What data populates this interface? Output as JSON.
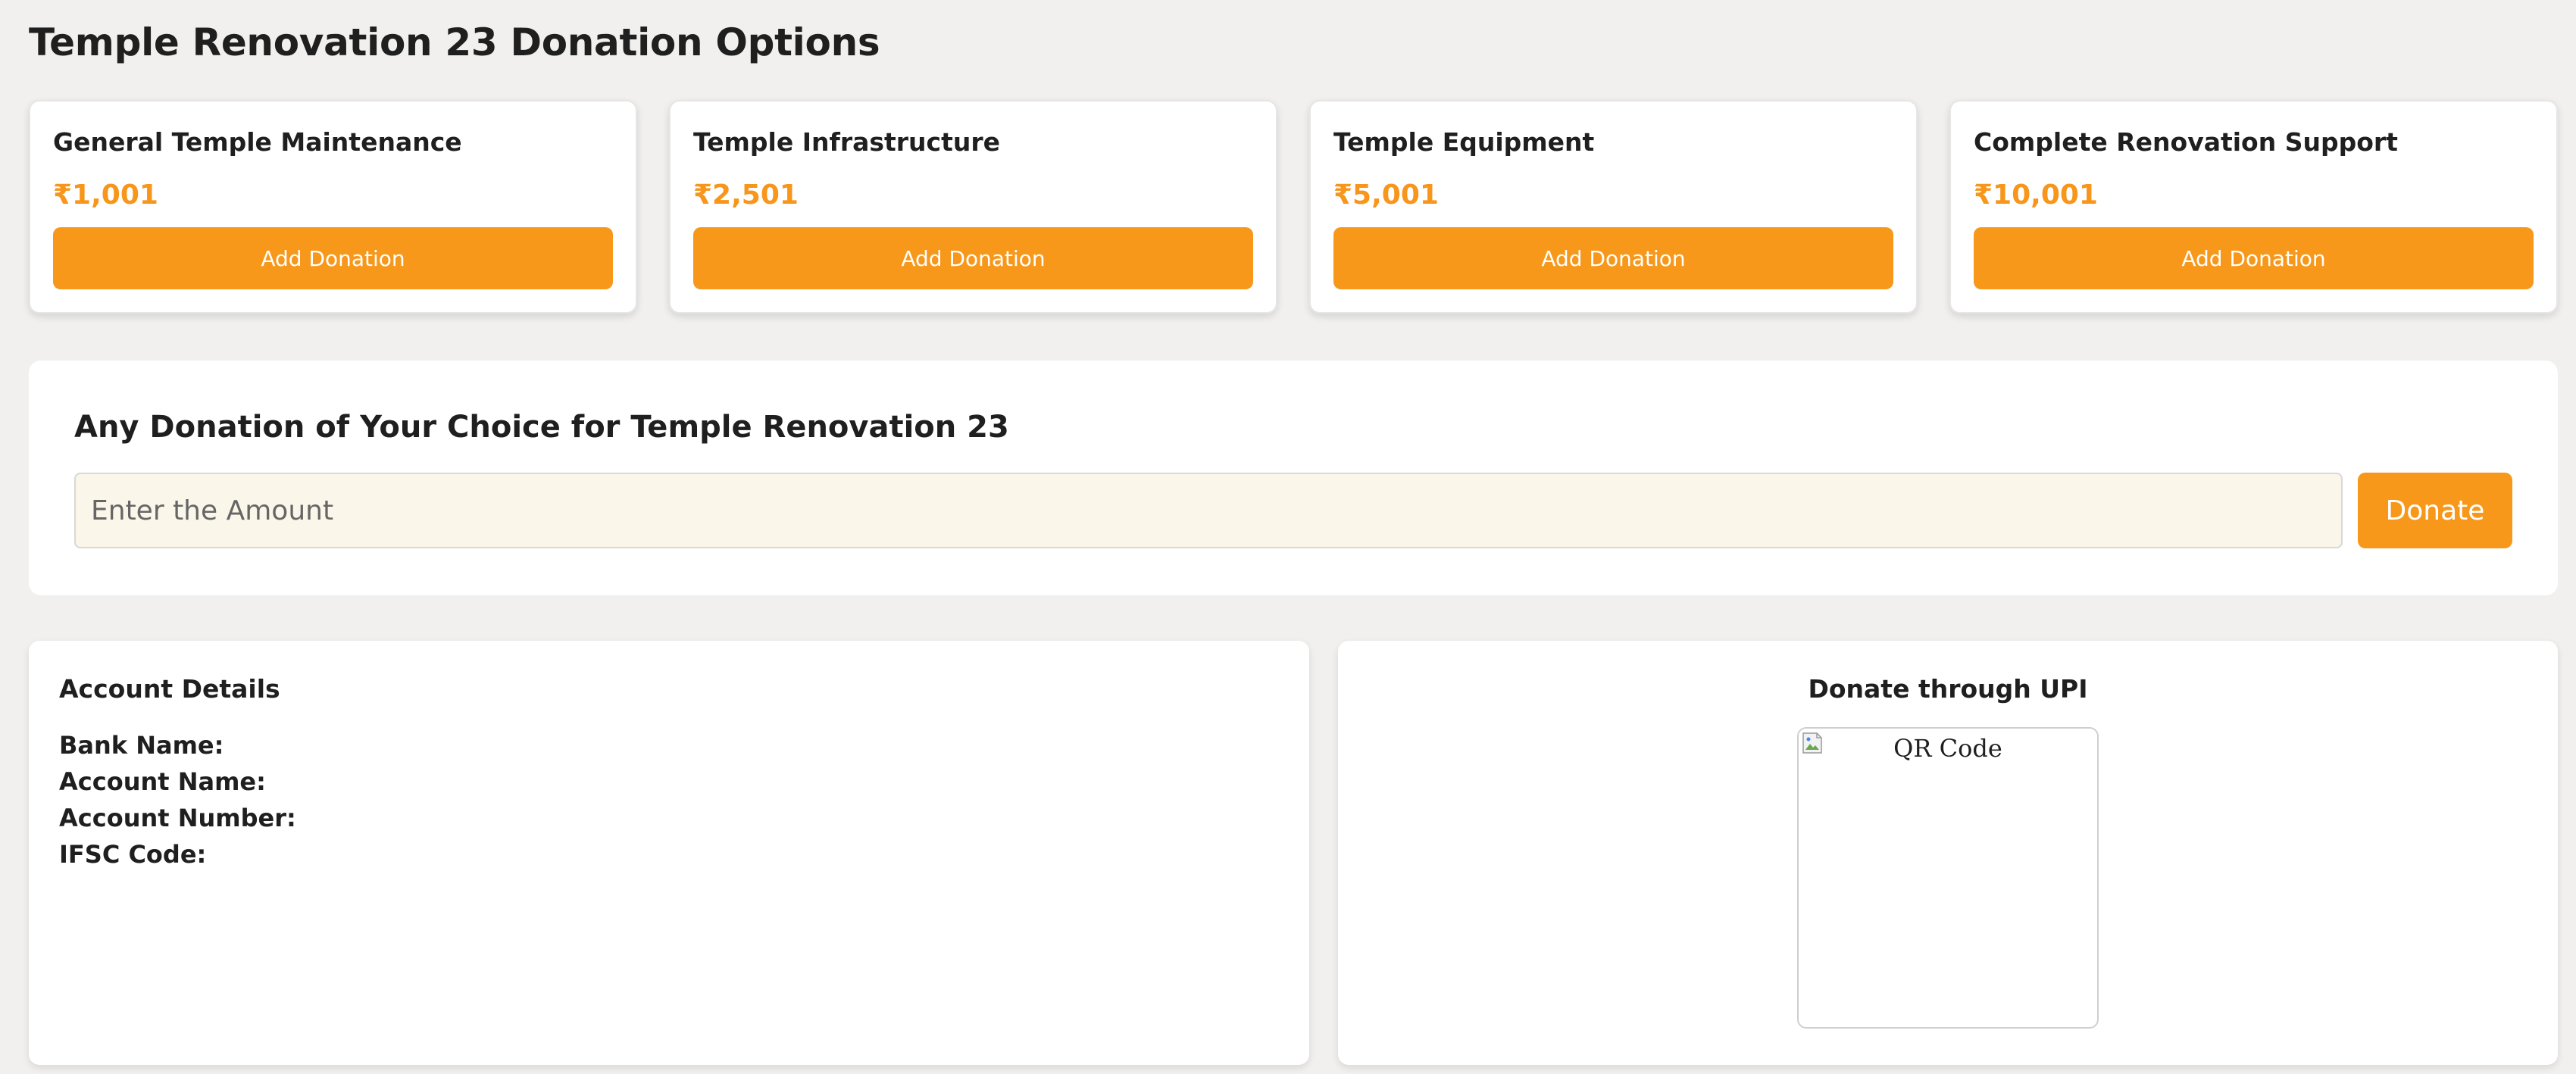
{
  "page": {
    "title": "Temple Renovation 23 Donation Options"
  },
  "options": [
    {
      "name": "General Temple Maintenance",
      "price": "₹1,001",
      "button": "Add Donation"
    },
    {
      "name": "Temple Infrastructure",
      "price": "₹2,501",
      "button": "Add Donation"
    },
    {
      "name": "Temple Equipment",
      "price": "₹5,001",
      "button": "Add Donation"
    },
    {
      "name": "Complete Renovation Support",
      "price": "₹10,001",
      "button": "Add Donation"
    }
  ],
  "custom_donation": {
    "title": "Any Donation of Your Choice for Temple Renovation 23",
    "input_value": "",
    "input_placeholder": "Enter the Amount",
    "donate_label": "Donate"
  },
  "account": {
    "title": "Account Details",
    "bank_name_label": "Bank Name:",
    "account_name_label": "Account Name:",
    "account_number_label": "Account Number:",
    "ifsc_label": "IFSC Code:"
  },
  "upi": {
    "title": "Donate through UPI",
    "qr_alt": "QR Code",
    "qr_icon": "broken-image-icon"
  },
  "colors": {
    "accent": "#f7981a",
    "price": "#f7961a",
    "background": "#f1f0ee",
    "input_bg": "#faf6ea"
  }
}
